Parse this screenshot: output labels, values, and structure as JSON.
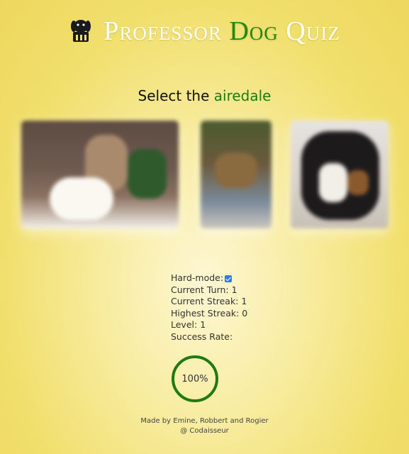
{
  "header": {
    "title_prefix": "Professor ",
    "title_accent": "Dog",
    "title_suffix": " Quiz",
    "logo_icon": "dog-head-icon"
  },
  "question": {
    "prefix": "Select the ",
    "breed": "airedale"
  },
  "images": [
    {
      "name": "dog-image-1"
    },
    {
      "name": "dog-image-2"
    },
    {
      "name": "dog-image-3"
    }
  ],
  "stats": {
    "hard_mode_label": "Hard-mode:",
    "hard_mode_checked": true,
    "current_turn_label": "Current Turn:",
    "current_turn": "1",
    "current_streak_label": "Current Streak:",
    "current_streak": "1",
    "highest_streak_label": "Highest Streak:",
    "highest_streak": "0",
    "level_label": "Level:",
    "level": "1",
    "success_rate_label": "Success Rate:",
    "success_rate": "100%"
  },
  "footer": {
    "line1": "Made by Emine, Robbert and Rogier",
    "line2": "@ Codaisseur"
  },
  "colors": {
    "accent": "#1f7a12",
    "background": "#f1df6c",
    "checkbox": "#2f7de1"
  }
}
